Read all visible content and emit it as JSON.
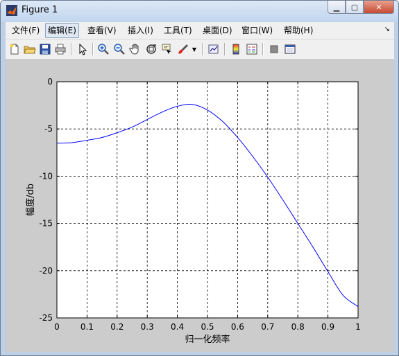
{
  "window": {
    "title": "Figure 1"
  },
  "menu": [
    "文件(F)",
    "编辑(E)",
    "查看(V)",
    "插入(I)",
    "工具(T)",
    "桌面(D)",
    "窗口(W)",
    "帮助(H)"
  ],
  "toolbar": {
    "icons": [
      "new-file-icon",
      "open-folder-icon",
      "save-icon",
      "print-icon",
      "pointer-icon",
      "zoom-in-icon",
      "zoom-out-icon",
      "pan-hand-icon",
      "rotate-3d-icon",
      "data-cursor-icon",
      "brush-icon",
      "link-plot-icon",
      "colorbar-icon",
      "legend-icon",
      "hide-plot-tools-icon",
      "show-plot-tools-icon"
    ]
  },
  "chart_data": {
    "type": "line",
    "title": "",
    "xlabel": "归一化频率",
    "ylabel": "幅度/db",
    "xlim": [
      0,
      1
    ],
    "ylim": [
      -25,
      0
    ],
    "xticks": [
      "0",
      "0.1",
      "0.2",
      "0.3",
      "0.4",
      "0.5",
      "0.6",
      "0.7",
      "0.8",
      "0.9",
      "1"
    ],
    "yticks": [
      "0",
      "-5",
      "-10",
      "-15",
      "-20",
      "-25"
    ],
    "grid": true,
    "series": [
      {
        "color": "#0000ff",
        "x": [
          0,
          0.05,
          0.1,
          0.15,
          0.2,
          0.25,
          0.3,
          0.35,
          0.4,
          0.45,
          0.5,
          0.55,
          0.6,
          0.65,
          0.7,
          0.75,
          0.8,
          0.85,
          0.9,
          0.95,
          1.0
        ],
        "y": [
          -6.5,
          -6.45,
          -6.2,
          -5.9,
          -5.4,
          -4.8,
          -4.0,
          -3.2,
          -2.6,
          -2.4,
          -3.0,
          -4.2,
          -5.9,
          -7.9,
          -10.1,
          -12.5,
          -15.0,
          -17.5,
          -20.1,
          -22.6,
          -23.8
        ]
      }
    ]
  }
}
